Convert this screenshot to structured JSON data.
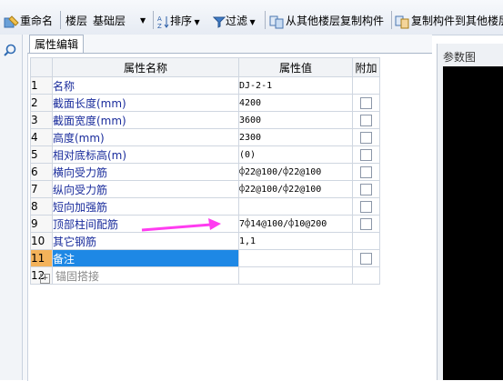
{
  "toolbar": {
    "rename": "重命名",
    "floor_label": "楼层",
    "floor_value": "基础层",
    "sort": "排序",
    "filter": "过滤",
    "copy_from": "从其他楼层复制构件",
    "copy_to": "复制构件到其他楼层"
  },
  "tab": {
    "label": "属性编辑"
  },
  "table": {
    "headers": {
      "name": "属性名称",
      "value": "属性值",
      "add": "附加"
    },
    "rows": [
      {
        "num": "1",
        "name": "名称",
        "value": "DJ-2-1"
      },
      {
        "num": "2",
        "name": "截面长度(mm)",
        "value": "4200"
      },
      {
        "num": "3",
        "name": "截面宽度(mm)",
        "value": "3600"
      },
      {
        "num": "4",
        "name": "高度(mm)",
        "value": "2300"
      },
      {
        "num": "5",
        "name": "相对底标高(m)",
        "value": "(0)"
      },
      {
        "num": "6",
        "name": "横向受力筋",
        "value": "⌽22@100/⌽22@100"
      },
      {
        "num": "7",
        "name": "纵向受力筋",
        "value": "⌽22@100/⌽22@100"
      },
      {
        "num": "8",
        "name": "短向加强筋",
        "value": ""
      },
      {
        "num": "9",
        "name": "顶部柱间配筋",
        "value": "7⌽14@100/⌽10@200"
      },
      {
        "num": "10",
        "name": "其它钢筋",
        "value": "1,1"
      },
      {
        "num": "11",
        "name": "备注",
        "value": ""
      },
      {
        "num": "12",
        "name": "锚固搭接",
        "value": ""
      }
    ]
  },
  "right_panel": {
    "title": "参数图"
  },
  "colors": {
    "selected_row": "#1e88e5",
    "header_value": "#f4c37a",
    "arrow": "#ff3cf0",
    "link_text": "#1a2c9c"
  }
}
